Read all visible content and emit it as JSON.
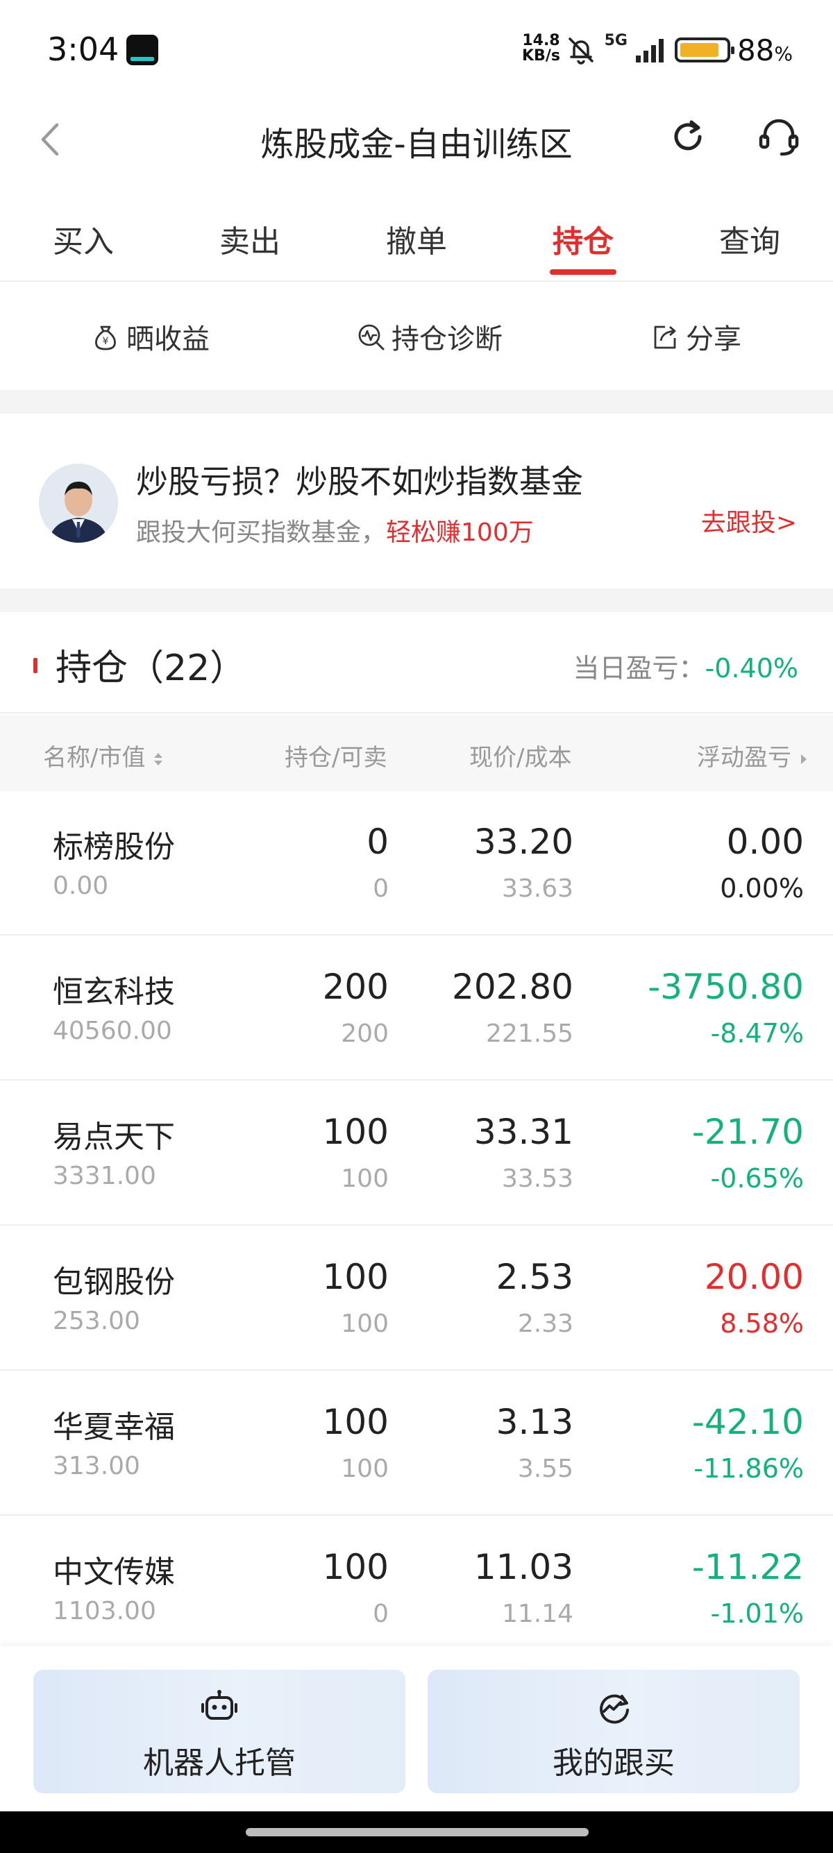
{
  "status_bar": {
    "time": "3:04",
    "net_speed_top": "14.8",
    "net_speed_bottom": "KB/s",
    "network": "5G",
    "battery_percent": "88",
    "battery_unit": "%",
    "battery_level": 0.88,
    "icons": [
      "app-icon",
      "bell-muted-icon",
      "signal-icon",
      "battery-icon"
    ]
  },
  "header": {
    "title": "炼股成金-自由训练区",
    "icons": [
      "back-icon",
      "refresh-icon",
      "customer-service-icon"
    ]
  },
  "tabs": [
    {
      "label": "买入",
      "active": false
    },
    {
      "label": "卖出",
      "active": false
    },
    {
      "label": "撤单",
      "active": false
    },
    {
      "label": "持仓",
      "active": true
    },
    {
      "label": "查询",
      "active": false
    }
  ],
  "actions": [
    {
      "label": "晒收益",
      "icon": "money-bag-icon"
    },
    {
      "label": "持仓诊断",
      "icon": "diagnosis-icon"
    },
    {
      "label": "分享",
      "icon": "share-icon"
    }
  ],
  "promo": {
    "title": "炒股亏损？炒股不如炒指数基金",
    "sub_prefix": "跟投大何买指数基金，",
    "sub_highlight": "轻松赚100万",
    "link": "去跟投>"
  },
  "holdings": {
    "title": "持仓（22）",
    "daily_pnl_label": "当日盈亏：",
    "daily_pnl_value": "-0.40%",
    "columns": {
      "name": "名称/市值",
      "position": "持仓/可卖",
      "price": "现价/成本",
      "pnl": "浮动盈亏"
    },
    "rows": [
      {
        "name": "标榜股份",
        "market_value": "0.00",
        "qty": "0",
        "available": "0",
        "price": "33.20",
        "cost": "33.63",
        "pnl": "0.00",
        "pnl_pct": "0.00%",
        "trend": "neutral"
      },
      {
        "name": "恒玄科技",
        "market_value": "40560.00",
        "qty": "200",
        "available": "200",
        "price": "202.80",
        "cost": "221.55",
        "pnl": "-3750.80",
        "pnl_pct": "-8.47%",
        "trend": "loss"
      },
      {
        "name": "易点天下",
        "market_value": "3331.00",
        "qty": "100",
        "available": "100",
        "price": "33.31",
        "cost": "33.53",
        "pnl": "-21.70",
        "pnl_pct": "-0.65%",
        "trend": "loss"
      },
      {
        "name": "包钢股份",
        "market_value": "253.00",
        "qty": "100",
        "available": "100",
        "price": "2.53",
        "cost": "2.33",
        "pnl": "20.00",
        "pnl_pct": "8.58%",
        "trend": "gain"
      },
      {
        "name": "华夏幸福",
        "market_value": "313.00",
        "qty": "100",
        "available": "100",
        "price": "3.13",
        "cost": "3.55",
        "pnl": "-42.10",
        "pnl_pct": "-11.86%",
        "trend": "loss"
      },
      {
        "name": "中文传媒",
        "market_value": "1103.00",
        "qty": "100",
        "available": "0",
        "price": "11.03",
        "cost": "11.14",
        "pnl": "-11.22",
        "pnl_pct": "-1.01%",
        "trend": "loss"
      }
    ]
  },
  "bottom_buttons": [
    {
      "label": "机器人托管",
      "icon": "robot-icon"
    },
    {
      "label": "我的跟买",
      "icon": "follow-trend-icon"
    }
  ],
  "colors": {
    "accent_red": "#e12e2e",
    "loss_green": "#12b27a",
    "text_dark": "#222222",
    "text_muted": "#aaaaaa"
  }
}
